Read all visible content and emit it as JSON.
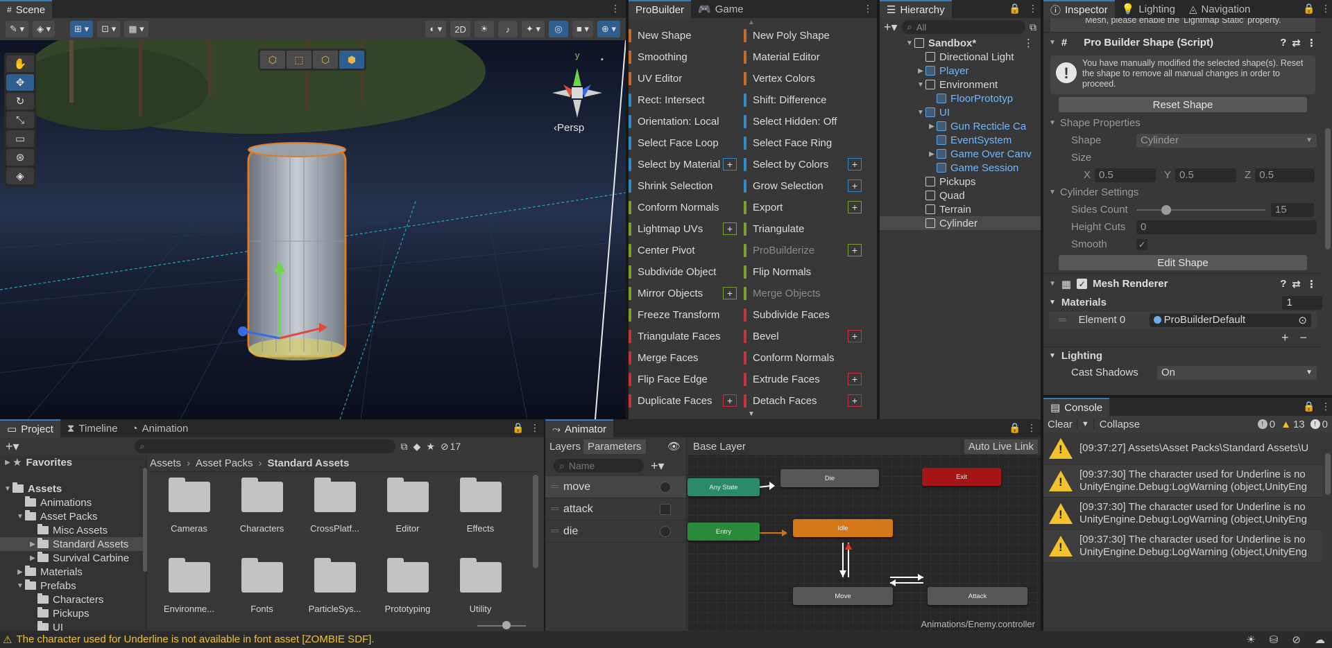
{
  "scene": {
    "tab": "Scene",
    "toolbar": {
      "mode_2d": "2D"
    },
    "persp_label": "‹Persp",
    "gizmo_axis": "y"
  },
  "probuilder": {
    "tabs": [
      "ProBuilder",
      "Game"
    ],
    "items": [
      {
        "label": "New Shape",
        "color": "or",
        "plus": false,
        "disabled": false
      },
      {
        "label": "New Poly Shape",
        "color": "or",
        "plus": false,
        "disabled": false
      },
      {
        "label": "Smoothing",
        "color": "or",
        "plus": false,
        "disabled": false
      },
      {
        "label": "Material Editor",
        "color": "or",
        "plus": false,
        "disabled": false
      },
      {
        "label": "UV Editor",
        "color": "or",
        "plus": false,
        "disabled": false
      },
      {
        "label": "Vertex Colors",
        "color": "or",
        "plus": false,
        "disabled": false
      },
      {
        "label": "Rect: Intersect",
        "color": "bl",
        "plus": false,
        "disabled": false
      },
      {
        "label": "Shift: Difference",
        "color": "bl",
        "plus": false,
        "disabled": false
      },
      {
        "label": "Orientation: Local",
        "color": "bl",
        "plus": false,
        "disabled": false
      },
      {
        "label": "Select Hidden: Off",
        "color": "bl",
        "plus": false,
        "disabled": false
      },
      {
        "label": "Select Face Loop",
        "color": "bl",
        "plus": false,
        "disabled": false
      },
      {
        "label": "Select Face Ring",
        "color": "bl",
        "plus": false,
        "disabled": false
      },
      {
        "label": "Select by Material",
        "color": "bl",
        "plus": true,
        "disabled": false
      },
      {
        "label": "Select by Colors",
        "color": "bl",
        "plus": true,
        "disabled": false
      },
      {
        "label": "Shrink Selection",
        "color": "bl",
        "plus": false,
        "disabled": false
      },
      {
        "label": "Grow Selection",
        "color": "bl",
        "plus": true,
        "disabled": false
      },
      {
        "label": "Conform Normals",
        "color": "gr",
        "plus": false,
        "disabled": false
      },
      {
        "label": "Export",
        "color": "gr",
        "plus": true,
        "disabled": false
      },
      {
        "label": "Lightmap UVs",
        "color": "gr",
        "plus": true,
        "disabled": false
      },
      {
        "label": "Triangulate",
        "color": "gr",
        "plus": false,
        "disabled": false
      },
      {
        "label": "Center Pivot",
        "color": "gr",
        "plus": false,
        "disabled": false
      },
      {
        "label": "ProBuilderize",
        "color": "gr",
        "plus": true,
        "disabled": true
      },
      {
        "label": "Subdivide Object",
        "color": "gr",
        "plus": false,
        "disabled": false
      },
      {
        "label": "Flip Normals",
        "color": "gr",
        "plus": false,
        "disabled": false
      },
      {
        "label": "Mirror Objects",
        "color": "gr",
        "plus": true,
        "disabled": false
      },
      {
        "label": "Merge Objects",
        "color": "gr",
        "plus": false,
        "disabled": true
      },
      {
        "label": "Freeze Transform",
        "color": "gr",
        "plus": false,
        "disabled": false
      },
      {
        "label": "Subdivide Faces",
        "color": "rd",
        "plus": false,
        "disabled": false
      },
      {
        "label": "Triangulate Faces",
        "color": "rd",
        "plus": false,
        "disabled": false
      },
      {
        "label": "Bevel",
        "color": "rd",
        "plus": true,
        "disabled": false
      },
      {
        "label": "Merge Faces",
        "color": "rd",
        "plus": false,
        "disabled": false
      },
      {
        "label": "Conform Normals",
        "color": "rd",
        "plus": false,
        "disabled": false
      },
      {
        "label": "Flip Face Edge",
        "color": "rd",
        "plus": false,
        "disabled": false
      },
      {
        "label": "Extrude Faces",
        "color": "rd",
        "plus": true,
        "disabled": false
      },
      {
        "label": "Duplicate Faces",
        "color": "rd",
        "plus": true,
        "disabled": false
      },
      {
        "label": "Detach Faces",
        "color": "rd",
        "plus": true,
        "disabled": false
      }
    ]
  },
  "hierarchy": {
    "tab": "Hierarchy",
    "search_placeholder": "All",
    "rows": [
      {
        "label": "Sandbox*",
        "depth": 0,
        "arrow": "▼",
        "prefab": false,
        "bold": true,
        "selected": false,
        "icon": "scene"
      },
      {
        "label": "Directional Light",
        "depth": 1,
        "arrow": "",
        "prefab": false,
        "bold": false,
        "selected": false,
        "icon": "cube"
      },
      {
        "label": "Player",
        "depth": 1,
        "arrow": "▶",
        "prefab": true,
        "bold": false,
        "selected": false,
        "icon": "cube"
      },
      {
        "label": "Environment",
        "depth": 1,
        "arrow": "▼",
        "prefab": false,
        "bold": false,
        "selected": false,
        "icon": "cube"
      },
      {
        "label": "FloorPrototyp",
        "depth": 2,
        "arrow": "",
        "prefab": true,
        "bold": false,
        "selected": false,
        "icon": "cube"
      },
      {
        "label": "UI",
        "depth": 1,
        "arrow": "▼",
        "prefab": true,
        "bold": false,
        "selected": false,
        "icon": "cube"
      },
      {
        "label": "Gun Recticle Ca",
        "depth": 2,
        "arrow": "▶",
        "prefab": true,
        "bold": false,
        "selected": false,
        "icon": "cube"
      },
      {
        "label": "EventSystem",
        "depth": 2,
        "arrow": "",
        "prefab": true,
        "bold": false,
        "selected": false,
        "icon": "cube"
      },
      {
        "label": "Game Over Canv",
        "depth": 2,
        "arrow": "▶",
        "prefab": true,
        "bold": false,
        "selected": false,
        "icon": "cube"
      },
      {
        "label": "Game Session",
        "depth": 2,
        "arrow": "",
        "prefab": true,
        "bold": false,
        "selected": false,
        "icon": "cube"
      },
      {
        "label": "Pickups",
        "depth": 1,
        "arrow": "",
        "prefab": false,
        "bold": false,
        "selected": false,
        "icon": "cube"
      },
      {
        "label": "Quad",
        "depth": 1,
        "arrow": "",
        "prefab": false,
        "bold": false,
        "selected": false,
        "icon": "cube"
      },
      {
        "label": "Terrain",
        "depth": 1,
        "arrow": "",
        "prefab": false,
        "bold": false,
        "selected": false,
        "icon": "cube"
      },
      {
        "label": "Cylinder",
        "depth": 1,
        "arrow": "",
        "prefab": false,
        "bold": false,
        "selected": true,
        "icon": "cube"
      }
    ]
  },
  "inspector": {
    "tabs": [
      "Inspector",
      "Lighting",
      "Navigation"
    ],
    "top_text": "Mesh, please enable the 'Lightmap Static' property.",
    "pb_shape": {
      "title": "Pro Builder Shape (Script)",
      "help": "You have manually modified the selected shape(s). Reset the shape to remove all manual changes in order to proceed.",
      "reset_label": "Reset Shape",
      "shape_props_label": "Shape Properties",
      "shape_key": "Shape",
      "shape_value": "Cylinder",
      "size_key": "Size",
      "size_x_label": "X",
      "size_x": "0.5",
      "size_y_label": "Y",
      "size_y": "0.5",
      "size_z_label": "Z",
      "size_z": "0.5",
      "cyl_settings_label": "Cylinder Settings",
      "sides_key": "Sides Count",
      "sides_value": "15",
      "height_key": "Height Cuts",
      "height_value": "0",
      "smooth_key": "Smooth",
      "smooth_checked": "✓",
      "edit_label": "Edit Shape"
    },
    "mesh_renderer": {
      "title": "Mesh Renderer",
      "materials_label": "Materials",
      "materials_count": "1",
      "element_key": "Element 0",
      "element_value": "ProBuilderDefault",
      "lighting_label": "Lighting",
      "cast_shadows_key": "Cast Shadows",
      "cast_shadows_value": "On"
    }
  },
  "console": {
    "tab": "Console",
    "clear_label": "Clear",
    "collapse_label": "Collapse",
    "count_info": "0",
    "count_warn": "13",
    "count_error": "0",
    "entries": [
      {
        "line1": "[09:37:27] Assets\\Asset Packs\\Standard Assets\\U",
        "line2": ""
      },
      {
        "line1": "[09:37:30] The character used for Underline is no",
        "line2": "UnityEngine.Debug:LogWarning (object,UnityEng"
      },
      {
        "line1": "[09:37:30] The character used for Underline is no",
        "line2": "UnityEngine.Debug:LogWarning (object,UnityEng"
      },
      {
        "line1": "[09:37:30] The character used for Underline is no",
        "line2": "UnityEngine.Debug:LogWarning (object,UnityEng"
      }
    ]
  },
  "project": {
    "tabs": [
      "Project",
      "Timeline",
      "Animation"
    ],
    "hidden_count": "17",
    "tree": [
      {
        "label": "Favorites",
        "depth": 0,
        "arrow": "▶",
        "bold": true,
        "selected": false,
        "folder": false
      },
      {
        "label": "Assets",
        "depth": 0,
        "arrow": "▼",
        "bold": true,
        "selected": false,
        "folder": true
      },
      {
        "label": "Animations",
        "depth": 1,
        "arrow": "",
        "bold": false,
        "selected": false,
        "folder": true
      },
      {
        "label": "Asset Packs",
        "depth": 1,
        "arrow": "▼",
        "bold": false,
        "selected": false,
        "folder": true
      },
      {
        "label": "Misc Assets",
        "depth": 2,
        "arrow": "",
        "bold": false,
        "selected": false,
        "folder": true
      },
      {
        "label": "Standard Assets",
        "depth": 2,
        "arrow": "▶",
        "bold": false,
        "selected": true,
        "folder": true
      },
      {
        "label": "Survival Carbine",
        "depth": 2,
        "arrow": "▶",
        "bold": false,
        "selected": false,
        "folder": true
      },
      {
        "label": "Materials",
        "depth": 1,
        "arrow": "▶",
        "bold": false,
        "selected": false,
        "folder": true
      },
      {
        "label": "Prefabs",
        "depth": 1,
        "arrow": "▼",
        "bold": false,
        "selected": false,
        "folder": true
      },
      {
        "label": "Characters",
        "depth": 2,
        "arrow": "",
        "bold": false,
        "selected": false,
        "folder": true
      },
      {
        "label": "Pickups",
        "depth": 2,
        "arrow": "",
        "bold": false,
        "selected": false,
        "folder": true
      },
      {
        "label": "UI",
        "depth": 2,
        "arrow": "",
        "bold": false,
        "selected": false,
        "folder": true
      }
    ],
    "breadcrumb": [
      "Assets",
      "Asset Packs",
      "Standard Assets"
    ],
    "folders": [
      "Cameras",
      "Characters",
      "CrossPlatf...",
      "Editor",
      "Effects",
      "Environme...",
      "Fonts",
      "ParticleSys...",
      "Prototyping",
      "Utility"
    ]
  },
  "animator": {
    "tab": "Animator",
    "layers_label": "Layers",
    "params_label": "Parameters",
    "base_layer": "Base Layer",
    "auto_live": "Auto Live Link",
    "name_placeholder": "Name",
    "params": [
      {
        "name": "move",
        "type": "bool"
      },
      {
        "name": "attack",
        "type": "trigger"
      },
      {
        "name": "die",
        "type": "bool"
      }
    ],
    "nodes": [
      {
        "label": "Any State",
        "color": "#2a8a6a"
      },
      {
        "label": "Die",
        "color": "#575757"
      },
      {
        "label": "Exit",
        "color": "#a51616"
      },
      {
        "label": "Entry",
        "color": "#2c8a3c"
      },
      {
        "label": "Idle",
        "color": "#d4761a"
      },
      {
        "label": "Move",
        "color": "#575757"
      },
      {
        "label": "Attack",
        "color": "#575757"
      }
    ],
    "controller_path": "Animations/Enemy.controller"
  },
  "status_bar": {
    "message": "The character used for Underline is not available in font asset [ZOMBIE SDF]."
  }
}
